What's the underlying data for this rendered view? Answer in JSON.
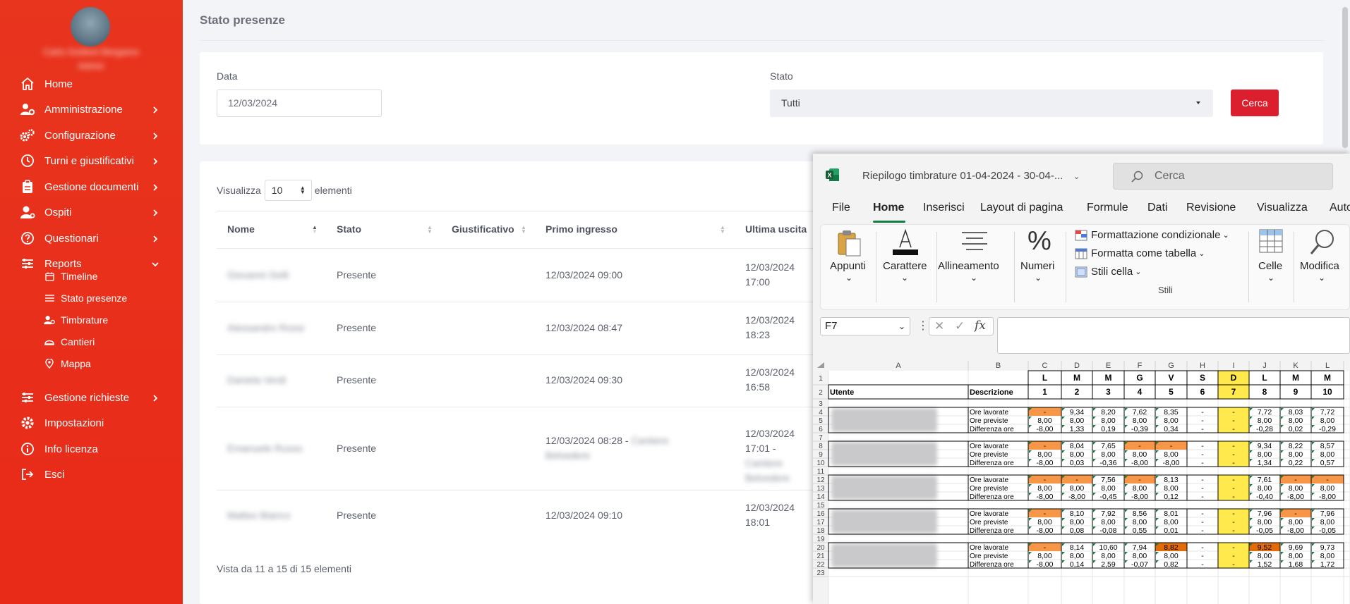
{
  "sidebar": {
    "user_name": "Carlo Goldoni Bergamo",
    "user_role": "Admin",
    "items": [
      {
        "label": "Home",
        "icon": "home-icon",
        "chevron": false
      },
      {
        "label": "Amministrazione",
        "icon": "users-gear-icon",
        "chevron": true
      },
      {
        "label": "Configurazione",
        "icon": "gears-icon",
        "chevron": true
      },
      {
        "label": "Turni e giustificativi",
        "icon": "clock-icon",
        "chevron": true
      },
      {
        "label": "Gestione documenti",
        "icon": "clipboard-icon",
        "chevron": true
      },
      {
        "label": "Ospiti",
        "icon": "user-icon",
        "chevron": true
      },
      {
        "label": "Questionari",
        "icon": "question-icon",
        "chevron": true
      },
      {
        "label": "Reports",
        "icon": "sliders-icon",
        "chevron": "down"
      }
    ],
    "subitems": [
      {
        "label": "Timeline",
        "icon": "calendar-icon"
      },
      {
        "label": "Stato presenze",
        "icon": "list-icon"
      },
      {
        "label": "Timbrature",
        "icon": "user-clock-icon"
      },
      {
        "label": "Cantieri",
        "icon": "helmet-icon"
      },
      {
        "label": "Mappa",
        "icon": "map-pin-icon"
      }
    ],
    "items_bottom": [
      {
        "label": "Gestione richieste",
        "icon": "sliders-icon",
        "chevron": true
      },
      {
        "label": "Impostazioni",
        "icon": "gear-icon",
        "chevron": false
      },
      {
        "label": "Info licenza",
        "icon": "info-icon",
        "chevron": false
      },
      {
        "label": "Esci",
        "icon": "logout-icon",
        "chevron": false
      }
    ]
  },
  "main": {
    "title": "Stato presenze",
    "filters": {
      "date_label": "Data",
      "date_value": "12/03/2024",
      "state_label": "Stato",
      "state_value": "Tutti",
      "search_button": "Cerca"
    },
    "table": {
      "show_prefix": "Visualizza",
      "page_length": "10",
      "show_suffix": "elementi",
      "columns": [
        "Nome",
        "Stato",
        "Giustificativo",
        "Primo ingresso",
        "Ultima uscita"
      ],
      "rows": [
        {
          "nome": "Giovanni Gelli",
          "stato": "Presente",
          "giust": "",
          "primo": "12/03/2024 09:00",
          "primo2": "",
          "ultima": "12/03/2024",
          "ultima2": "17:00",
          "ultima3": ""
        },
        {
          "nome": "Alessandro Rossi",
          "stato": "Presente",
          "giust": "",
          "primo": "12/03/2024 08:47",
          "primo2": "",
          "ultima": "12/03/2024",
          "ultima2": "18:23",
          "ultima3": ""
        },
        {
          "nome": "Daniela Verdi",
          "stato": "Presente",
          "giust": "",
          "primo": "12/03/2024 09:30",
          "primo2": "",
          "ultima": "12/03/2024",
          "ultima2": "16:58",
          "ultima3": ""
        },
        {
          "nome": "Emanuele Russo",
          "stato": "Presente",
          "giust": "",
          "primo": "12/03/2024 08:28 - Cantiere",
          "primo2": "Belvedere",
          "ultima": "12/03/2024",
          "ultima2": "17:01 -",
          "ultima3": "Cantiere Belvedere"
        },
        {
          "nome": "Matteo Bianco",
          "stato": "Presente",
          "giust": "",
          "primo": "12/03/2024 09:10",
          "primo2": "",
          "ultima": "12/03/2024",
          "ultima2": "18:01",
          "ultima3": ""
        }
      ],
      "footer": "Vista da 11 a 15 di 15 elementi"
    }
  },
  "excel": {
    "doc_title": "Riepilogo timbrature 01-04-2024 - 30-04-...",
    "search_placeholder": "Cerca",
    "tabs": [
      "File",
      "Home",
      "Inserisci",
      "Layout di pagina",
      "Formule",
      "Dati",
      "Revisione",
      "Visualizza",
      "Auto"
    ],
    "ribbon": {
      "appunti": "Appunti",
      "carattere": "Carattere",
      "allineamento": "Allineamento",
      "numeri": "Numeri",
      "formattazione": "Formattazione condizionale",
      "formatta_tabella": "Formatta come tabella",
      "stili_cella": "Stili cella",
      "stili": "Stili",
      "celle": "Celle",
      "modifica": "Modifica"
    },
    "namebox": "F7",
    "formula": "",
    "columns": [
      "A",
      "B",
      "C",
      "D",
      "E",
      "F",
      "G",
      "H",
      "I",
      "J",
      "K",
      "L"
    ],
    "day_letters": [
      "L",
      "M",
      "M",
      "G",
      "V",
      "S",
      "D",
      "L",
      "M",
      "M"
    ],
    "day_numbers": [
      "1",
      "2",
      "3",
      "4",
      "5",
      "6",
      "7",
      "8",
      "9",
      "10"
    ],
    "header_utente": "Utente",
    "header_descrizione": "Descrizione",
    "label_lavorate": "Ore lavorate",
    "label_previste": "Ore previste",
    "label_differenza": "Differenza ore",
    "groups": [
      {
        "rows": [
          4,
          5,
          6
        ],
        "lav": [
          "-",
          "9,34",
          "8,20",
          "7,62",
          "8,35",
          "-",
          "-",
          "7,72",
          "8,03",
          "7,72"
        ],
        "pre": [
          "8,00",
          "8,00",
          "8,00",
          "8,00",
          "8,00",
          "-",
          "-",
          "8,00",
          "8,00",
          "8,00"
        ],
        "dif": [
          "-8,00",
          "1,33",
          "0,19",
          "-0,39",
          "0,34",
          "-",
          "-",
          "-0,28",
          "0,02",
          "-0,29"
        ]
      },
      {
        "rows": [
          8,
          9,
          10
        ],
        "lav": [
          "-",
          "8,04",
          "7,65",
          "-",
          "-",
          "-",
          "-",
          "9,34",
          "8,22",
          "8,57"
        ],
        "pre": [
          "8,00",
          "8,00",
          "8,00",
          "8,00",
          "8,00",
          "-",
          "-",
          "8,00",
          "8,00",
          "8,00"
        ],
        "dif": [
          "-8,00",
          "0,03",
          "-0,36",
          "-8,00",
          "-8,00",
          "-",
          "-",
          "1,34",
          "0,22",
          "0,57"
        ]
      },
      {
        "rows": [
          12,
          13,
          14
        ],
        "lav": [
          "-",
          "-",
          "7,56",
          "-",
          "8,13",
          "-",
          "-",
          "7,61",
          "-",
          "-"
        ],
        "pre": [
          "8,00",
          "8,00",
          "8,00",
          "8,00",
          "8,00",
          "-",
          "-",
          "8,00",
          "8,00",
          "8,00"
        ],
        "dif": [
          "-8,00",
          "-8,00",
          "-0,45",
          "-8,00",
          "0,12",
          "-",
          "-",
          "-0,40",
          "-8,00",
          "-8,00"
        ]
      },
      {
        "rows": [
          16,
          17,
          18
        ],
        "lav": [
          "-",
          "8,10",
          "7,92",
          "8,56",
          "8,01",
          "-",
          "-",
          "7,96",
          "-",
          "7,96"
        ],
        "pre": [
          "8,00",
          "8,00",
          "8,00",
          "8,00",
          "8,00",
          "-",
          "-",
          "8,00",
          "8,00",
          "8,00"
        ],
        "dif": [
          "-8,00",
          "0,08",
          "-0,08",
          "0,55",
          "0,01",
          "-",
          "-",
          "-0,05",
          "-8,00",
          "-0,05"
        ]
      },
      {
        "rows": [
          20,
          21,
          22
        ],
        "lav": [
          "-",
          "8,14",
          "10,60",
          "7,94",
          "8,82",
          "-",
          "-",
          "9,52",
          "9,69",
          "9,73"
        ],
        "pre": [
          "8,00",
          "8,00",
          "8,00",
          "8,00",
          "8,00",
          "-",
          "-",
          "8,00",
          "8,00",
          "8,00"
        ],
        "dif": [
          "-8,00",
          "0,14",
          "2,59",
          "-0,07",
          "0,82",
          "-",
          "-",
          "1,52",
          "1,68",
          "1,72"
        ]
      }
    ],
    "colors": {
      "orange": "#f79646",
      "dark_orange": "#e26b0a",
      "yellow": "#ffe94d",
      "green": "#107c41"
    }
  }
}
